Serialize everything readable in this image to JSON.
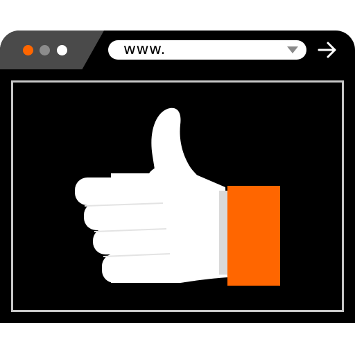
{
  "browser": {
    "window_controls": [
      "close",
      "minimize",
      "maximize"
    ],
    "colors": {
      "close": "#ff6600",
      "minimize": "#8c8c8c",
      "maximize": "#ffffff",
      "frame": "#000000",
      "tab": "#4a4a4a",
      "accent": "#ff6600",
      "viewport_border": "#c8c8c8"
    },
    "address": {
      "value": "www."
    },
    "icons": {
      "dropdown": "chevron-down-icon",
      "go": "arrow-right-icon"
    }
  },
  "content": {
    "illustration": "thumbs-up-icon",
    "colors": {
      "hand": "#ffffff",
      "hand_shadow": "#d9d9d9",
      "sleeve": "#ff6600"
    }
  }
}
